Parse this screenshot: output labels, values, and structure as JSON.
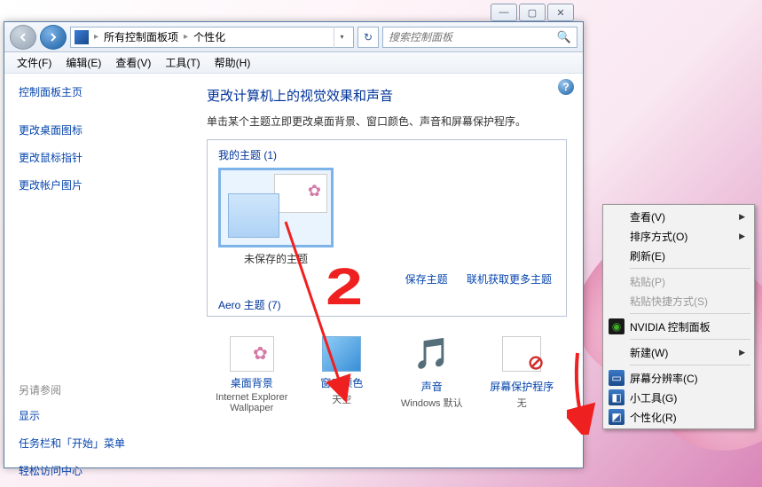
{
  "window_controls": {
    "min": "—",
    "max": "▢",
    "close": "✕"
  },
  "addressbar": {
    "crumb1": "所有控制面板项",
    "crumb2": "个性化"
  },
  "search": {
    "placeholder": "搜索控制面板"
  },
  "menubar": {
    "file": "文件(F)",
    "edit": "编辑(E)",
    "view": "查看(V)",
    "tools": "工具(T)",
    "help": "帮助(H)"
  },
  "sidebar": {
    "home": "控制面板主页",
    "icons": "更改桌面图标",
    "pointers": "更改鼠标指针",
    "account_pic": "更改帐户图片",
    "see_also_heading": "另请参阅",
    "display": "显示",
    "taskbar": "任务栏和「开始」菜单",
    "ease": "轻松访问中心"
  },
  "content": {
    "title": "更改计算机上的视觉效果和声音",
    "subtitle": "单击某个主题立即更改桌面背景、窗口颜色、声音和屏幕保护程序。",
    "my_themes_label": "我的主题 (1)",
    "unsaved_theme": "未保存的主题",
    "save_theme": "保存主题",
    "get_more": "联机获取更多主题",
    "aero_label": "Aero 主题 (7)"
  },
  "bottom": {
    "wallpaper": {
      "label": "桌面背景",
      "sub": "Internet Explorer Wallpaper"
    },
    "color": {
      "label": "窗口颜色",
      "sub": "天空"
    },
    "sound": {
      "label": "声音",
      "sub": "Windows 默认"
    },
    "saver": {
      "label": "屏幕保护程序",
      "sub": "无"
    }
  },
  "context_menu": {
    "view": "查看(V)",
    "sort": "排序方式(O)",
    "refresh": "刷新(E)",
    "paste": "粘贴(P)",
    "paste_shortcut": "粘贴快捷方式(S)",
    "nvidia": "NVIDIA 控制面板",
    "new": "新建(W)",
    "resolution": "屏幕分辨率(C)",
    "gadgets": "小工具(G)",
    "personalize": "个性化(R)"
  }
}
